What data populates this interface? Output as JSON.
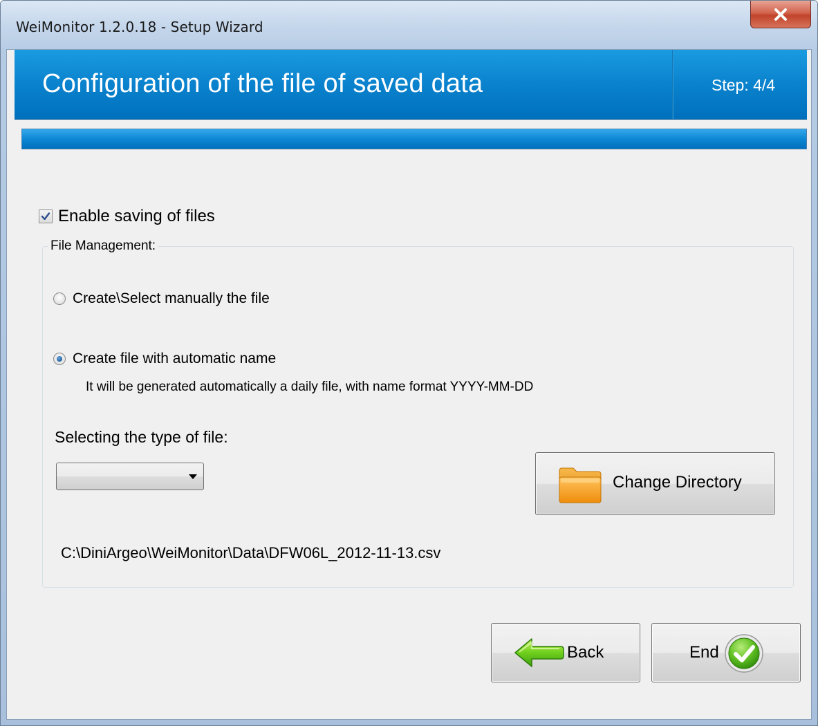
{
  "window": {
    "title": "WeiMonitor 1.2.0.18 - Setup Wizard",
    "close_glyph": "X"
  },
  "header": {
    "title": "Configuration of the file of saved data",
    "step": "Step: 4/4",
    "accent_color": "#0a82cd"
  },
  "progress": {
    "fraction": 1.0
  },
  "enable_saving": {
    "label": "Enable saving of files",
    "checked": true
  },
  "file_management": {
    "legend": "File Management:",
    "options": [
      {
        "label": "Create\\Select manually the file",
        "selected": false
      },
      {
        "label": "Create file with automatic name",
        "selected": true
      }
    ],
    "auto_description": "It will be generated automatically a daily file, with name format YYYY-MM-DD",
    "type_label": "Selecting the type of file:",
    "type_value": "",
    "change_directory_label": "Change Directory",
    "file_path": "C:\\DiniArgeo\\WeiMonitor\\Data\\DFW06L_2012-11-13.csv"
  },
  "footer": {
    "back_label": "Back",
    "end_label": "End"
  },
  "icons": {
    "close": "close-icon",
    "checkbox_check": "checkmark-icon",
    "folder": "folder-icon",
    "back": "back-arrow-icon",
    "end": "check-circle-icon"
  }
}
